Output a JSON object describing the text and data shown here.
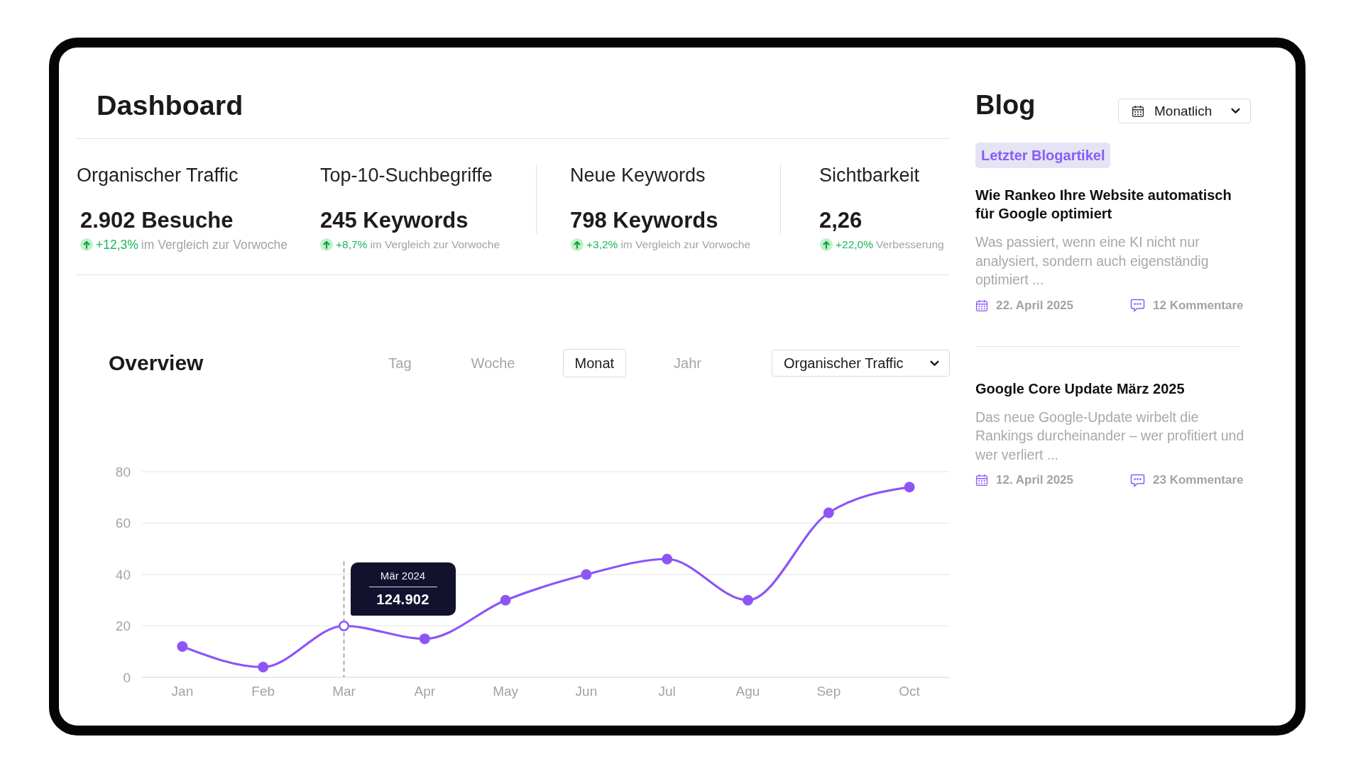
{
  "dashboard": {
    "title": "Dashboard",
    "stats": [
      {
        "label": "Organischer Traffic",
        "value": "2.902 Besuche",
        "change": "+12,3%",
        "note": "im Vergleich zur Vorwoche"
      },
      {
        "label": "Top-10-Suchbegriffe",
        "value": "245 Keywords",
        "change": "+8,7%",
        "note": "im Vergleich zur Vorwoche"
      },
      {
        "label": "Neue Keywords",
        "value": "798 Keywords",
        "change": "+3,2%",
        "note": "im Vergleich zur Vorwoche"
      },
      {
        "label": "Sichtbarkeit",
        "value": "2,26",
        "change": "+22,0%",
        "note": "Verbesserung"
      }
    ]
  },
  "overview": {
    "title": "Overview",
    "tabs": [
      {
        "label": "Tag",
        "selected": false
      },
      {
        "label": "Woche",
        "selected": false
      },
      {
        "label": "Monat",
        "selected": true
      },
      {
        "label": "Jahr",
        "selected": false
      }
    ],
    "metric_dropdown": {
      "value": "Organischer Traffic"
    },
    "chart_data": {
      "type": "line",
      "categories": [
        "Jan",
        "Feb",
        "Mar",
        "Apr",
        "May",
        "Jun",
        "Jul",
        "Agu",
        "Sep",
        "Oct"
      ],
      "values": [
        12,
        4,
        20,
        15,
        30,
        40,
        46,
        30,
        64,
        74
      ],
      "ylim": [
        0,
        80
      ],
      "yticks": [
        0,
        20,
        40,
        60,
        80
      ],
      "grid": true,
      "marker": "circle",
      "ref_lines": [
        {
          "axis": "x",
          "value": "Mar"
        }
      ],
      "annotations": [
        "Mär 2024",
        "124.902"
      ]
    }
  },
  "blog": {
    "title": "Blog",
    "period_dropdown": {
      "value": "Monatlich"
    },
    "badge": "Letzter Blogartikel",
    "articles": [
      {
        "title": "Wie Rankeo Ihre Website automatisch für Google optimiert",
        "excerpt": "Was passiert, wenn eine KI nicht nur analysiert, sondern auch eigenständig optimiert ...",
        "date": "22. April 2025",
        "comments": "12 Kommentare"
      },
      {
        "title": "Google Core Update März 2025",
        "excerpt": "Das neue Google-Update wirbelt die Rankings durcheinander – wer profitiert und wer verliert ...",
        "date": "12. April 2025",
        "comments": "23 Kommentare"
      }
    ]
  }
}
